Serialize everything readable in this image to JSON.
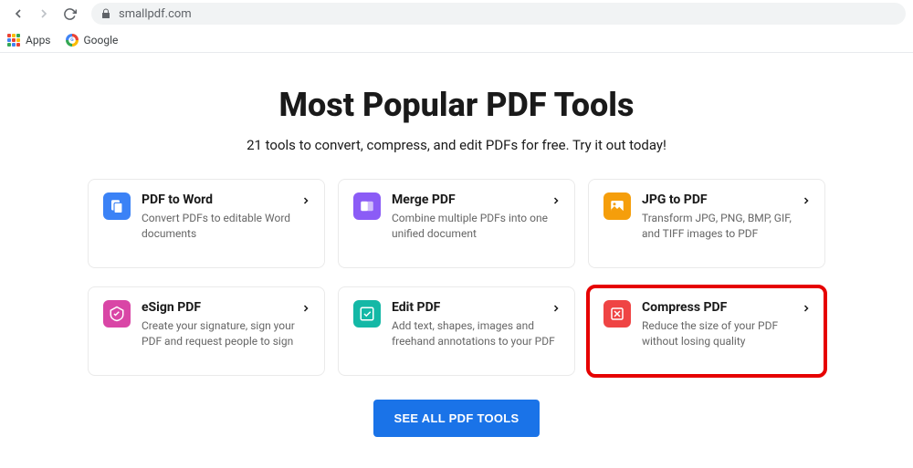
{
  "browser": {
    "url": "smallpdf.com",
    "bookmarks": {
      "apps": "Apps",
      "google": "Google"
    }
  },
  "page": {
    "title": "Most Popular PDF Tools",
    "subtitle": "21 tools to convert, compress, and edit PDFs for free. Try it out today!",
    "see_all_label": "SEE ALL PDF TOOLS"
  },
  "tools": [
    {
      "title": "PDF to Word",
      "desc": "Convert PDFs to editable Word documents",
      "color": "#3b82f6",
      "icon": "doc",
      "highlighted": false
    },
    {
      "title": "Merge PDF",
      "desc": "Combine multiple PDFs into one unified document",
      "color": "#8b5cf6",
      "icon": "merge",
      "highlighted": false
    },
    {
      "title": "JPG to PDF",
      "desc": "Transform JPG, PNG, BMP, GIF, and TIFF images to PDF",
      "color": "#f59e0b",
      "icon": "image",
      "highlighted": false
    },
    {
      "title": "eSign PDF",
      "desc": "Create your signature, sign your PDF and request people to sign",
      "color": "#d946a6",
      "icon": "sign",
      "highlighted": false
    },
    {
      "title": "Edit PDF",
      "desc": "Add text, shapes, images and freehand annotations to your PDF",
      "color": "#14b8a6",
      "icon": "edit",
      "highlighted": false
    },
    {
      "title": "Compress PDF",
      "desc": "Reduce the size of your PDF without losing quality",
      "color": "#ef4444",
      "icon": "compress",
      "highlighted": true
    }
  ]
}
